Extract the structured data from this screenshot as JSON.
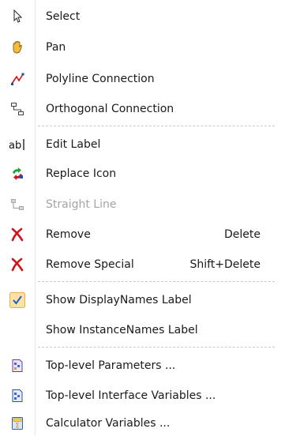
{
  "menu": {
    "items": [
      {
        "label": "Select",
        "icon": "cursor-arrow-icon"
      },
      {
        "label": "Pan",
        "icon": "hand-icon"
      },
      {
        "label": "Polyline Connection",
        "icon": "polyline-connection-icon"
      },
      {
        "label": "Orthogonal Connection",
        "icon": "orthogonal-connection-icon"
      },
      {
        "label": "Edit Label",
        "icon": "text-cursor-icon"
      },
      {
        "label": "Replace Icon",
        "icon": "replace-arrows-icon"
      },
      {
        "label": "Straight Line",
        "icon": "straight-line-icon",
        "disabled": true
      },
      {
        "label": "Remove",
        "shortcut": "Delete",
        "icon": "remove-icon"
      },
      {
        "label": "Remove Special",
        "shortcut": "Shift+Delete",
        "icon": "remove-special-icon"
      },
      {
        "label": "Show DisplayNames Label",
        "icon": "checkmark-icon",
        "checked": true
      },
      {
        "label": "Show InstanceNames Label"
      },
      {
        "label": "Top-level Parameters ...",
        "icon": "parameters-document-icon"
      },
      {
        "label": "Top-level Interface Variables ...",
        "icon": "interface-variables-document-icon"
      },
      {
        "label": "Calculator Variables ...",
        "icon": "calculator-icon"
      }
    ]
  },
  "colors": {
    "separator": "#c8c8c8",
    "disabled_text": "#a4a4a4",
    "remove_red": "#d4101a",
    "check_bg": "#fbe2a6"
  }
}
